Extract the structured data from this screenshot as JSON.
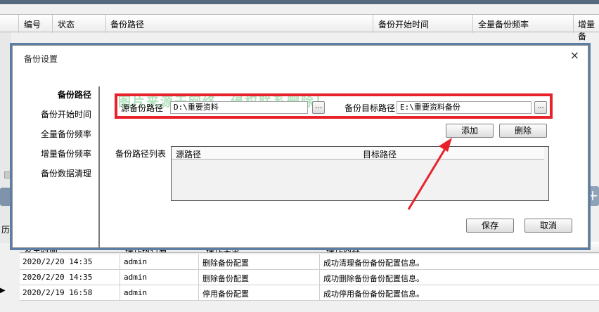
{
  "background": {
    "table_columns": [
      "编号",
      "状态",
      "备份路径",
      "备份开始时间",
      "全量备份频率",
      "增量备"
    ],
    "history_label": "历",
    "add_icon": "plus-icon"
  },
  "log": {
    "columns": [
      "发生时间",
      "操作执行者",
      "操作类型",
      "操作内容"
    ],
    "rows": [
      {
        "time": "2020/2/20 14:35",
        "user": "admin",
        "type": "删除备份配置",
        "content": "成功清理备份备份配置信息。"
      },
      {
        "time": "2020/2/20 14:35",
        "user": "admin",
        "type": "删除备份配置",
        "content": "成功删除备份备份配置信息。"
      },
      {
        "time": "2020/2/19 16:58",
        "user": "admin",
        "type": "停用备份配置",
        "content": "成功停用备份备份配置信息。"
      }
    ],
    "current_row_marker": "▶"
  },
  "modal": {
    "title": "备份设置",
    "close": "×",
    "nav": [
      "备份路径",
      "备份开始时间",
      "全量备份频率",
      "增量备份频率",
      "备份数据清理"
    ],
    "source_label": "源备份路径",
    "source_value": "D:\\重要资料",
    "target_label": "备份目标路径",
    "target_value": "E:\\重要资料备份",
    "browse": "...",
    "add_label": "添加",
    "delete_label": "删除",
    "list_label": "备份路径列表",
    "list_columns": [
      "源路径",
      "目标路径"
    ],
    "save_label": "保存",
    "cancel_label": "取消",
    "watermark": "图片来源于网络，侵权联系删除！"
  },
  "colors": {
    "highlight": "#e8222b",
    "arrow": "#e8222b",
    "title_strip": "#56687e"
  }
}
